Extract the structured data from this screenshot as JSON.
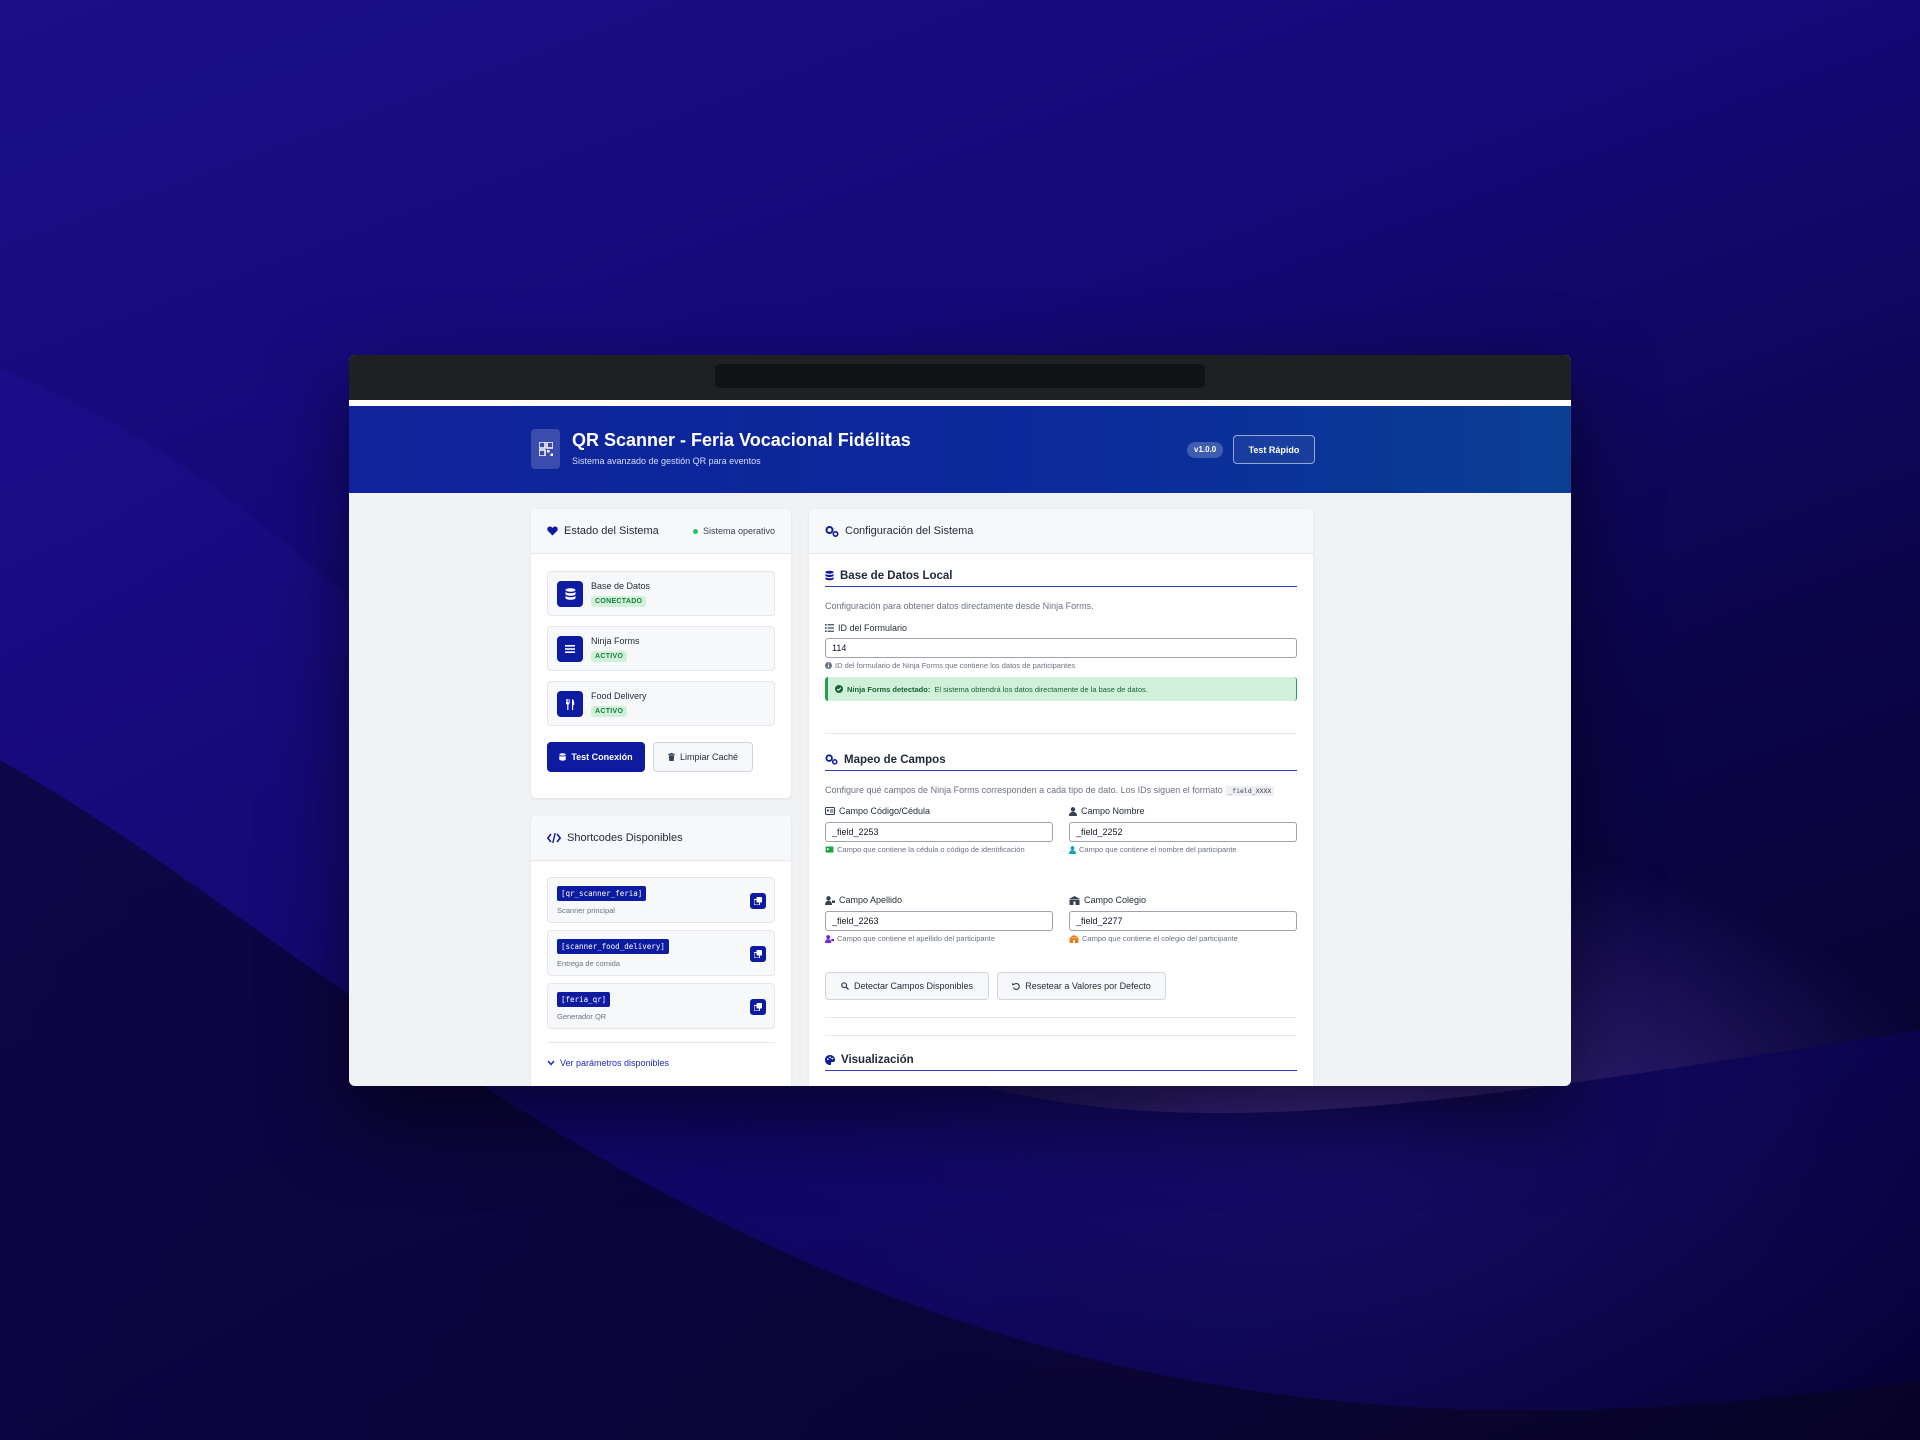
{
  "colors": {
    "primary": "#0c1ba0",
    "success": "#22a34a",
    "header_gradient_start": "#10239a",
    "header_gradient_end": "#0a3f93"
  },
  "header": {
    "title": "QR Scanner - Feria Vocacional Fidélitas",
    "subtitle": "Sistema avanzado de gestión QR para eventos",
    "version": "v1.0.0",
    "quick_test_label": "Test Rápido",
    "logo_icon": "qr-code-icon"
  },
  "system_status": {
    "title": "Estado del Sistema",
    "status_text": "Sistema operativo",
    "services": [
      {
        "name": "Base de Datos",
        "badge": "CONECTADO",
        "icon": "database-icon"
      },
      {
        "name": "Ninja Forms",
        "badge": "ACTIVO",
        "icon": "list-icon"
      },
      {
        "name": "Food Delivery",
        "badge": "ACTIVO",
        "icon": "utensils-icon"
      }
    ],
    "test_connection_label": "Test Conexión",
    "clear_cache_label": "Limpiar Caché"
  },
  "shortcodes": {
    "title": "Shortcodes Disponibles",
    "items": [
      {
        "code": "[qr_scanner_feria]",
        "desc": "Scanner principal"
      },
      {
        "code": "[scanner_food_delivery]",
        "desc": "Entrega de comida"
      },
      {
        "code": "[feria_qr]",
        "desc": "Generador QR"
      }
    ],
    "params_link": "Ver parámetros disponibles"
  },
  "config": {
    "title": "Configuración del Sistema",
    "local_db": {
      "title": "Base de Datos Local",
      "desc": "Configuración para obtener datos directamente desde Ninja Forms.",
      "form_id_label": "ID del Formulario",
      "form_id_value": "114",
      "form_id_hint": "ID del formulario de Ninja Forms que contiene los datos de participantes",
      "alert_strong": "Ninja Forms detectado:",
      "alert_text": "El sistema obtendrá los datos directamente de la base de datos."
    },
    "mapping": {
      "title": "Mapeo de Campos",
      "desc": "Configure qué campos de Ninja Forms corresponden a cada tipo de dato. Los IDs siguen el formato",
      "format_code": "_field_XXXX",
      "fields": [
        {
          "label": "Campo Código/Cédula",
          "value": "_field_2253",
          "hint": "Campo que contiene la cédula o código de identificación"
        },
        {
          "label": "Campo Nombre",
          "value": "_field_2252",
          "hint": "Campo que contiene el nombre del participante"
        },
        {
          "label": "Campo Apellido",
          "value": "_field_2263",
          "hint": "Campo que contiene el apellido del participante"
        },
        {
          "label": "Campo Colegio",
          "value": "_field_2277",
          "hint": "Campo que contiene el colegio del participante"
        }
      ],
      "detect_label": "Detectar Campos Disponibles",
      "reset_label": "Resetear a Valores por Defecto"
    },
    "visual": {
      "title": "Visualización"
    }
  }
}
